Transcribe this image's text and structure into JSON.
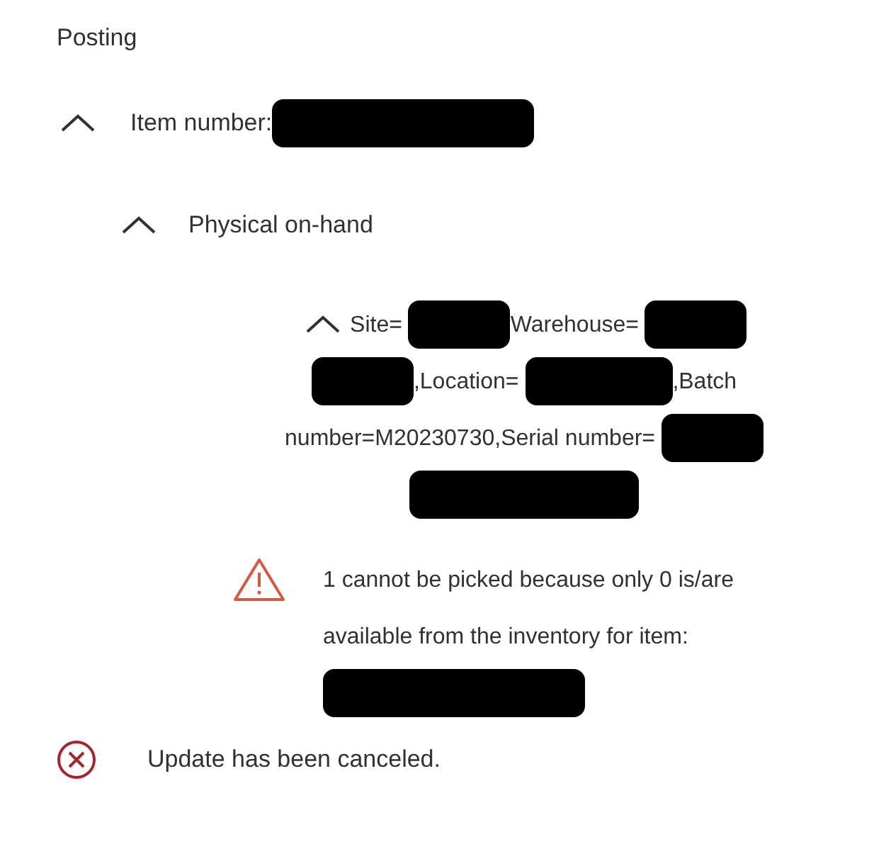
{
  "section_title": "Posting",
  "tree": {
    "label": "Item number:",
    "redacted_after": true,
    "expanded": true,
    "children": [
      {
        "label": "Physical on-hand",
        "expanded": true,
        "children": [
          {
            "expanded": true,
            "segments": [
              {
                "kind": "text",
                "text": "Site="
              },
              {
                "kind": "redacted_small"
              },
              {
                "kind": "text",
                "text": "Warehouse="
              },
              {
                "kind": "redacted_small"
              },
              {
                "kind": "redacted_small"
              },
              {
                "kind": "text",
                "text": ",Location="
              },
              {
                "kind": "redacted_medium"
              },
              {
                "kind": "text",
                "text": ",Batch"
              },
              {
                "kind": "text",
                "text": "number=M20230730,Serial number="
              },
              {
                "kind": "redacted_small"
              },
              {
                "kind": "redacted_large"
              }
            ],
            "messages": [
              {
                "kind": "warning",
                "text": "1 cannot be picked because only 0 is/are available from the inventory for item:",
                "redacted_after": true
              }
            ]
          }
        ]
      }
    ]
  },
  "result": {
    "kind": "error",
    "text": "Update has been canceled."
  }
}
